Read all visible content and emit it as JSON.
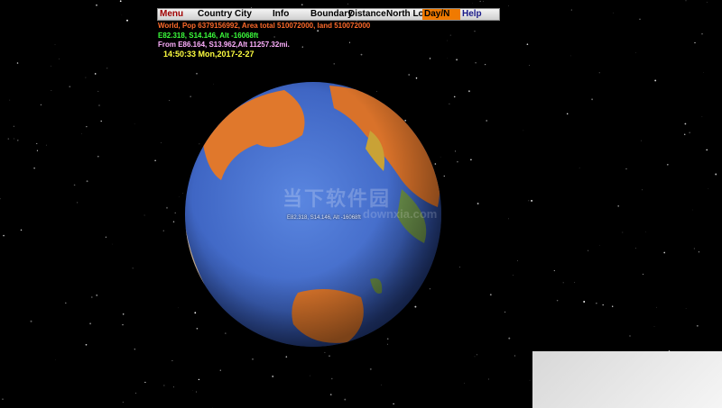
{
  "menu": {
    "items": [
      "Menu",
      "Country",
      "City",
      "Info",
      "Boundary",
      "Distance",
      "North Lock",
      "Day/N",
      "Help"
    ]
  },
  "info": {
    "line1": "World, Pop  6379156992, Area total 510072000, land 510072000",
    "line2": "E82.318, S14.146, Alt -16068ft",
    "line3": "From E86.164, S13.962,Alt 11257.32mi.",
    "clock": "14:50:33 Mon,2017-2-27"
  },
  "globe": {
    "cursor_label": "E82.318, S14.146, Alt -16068ft"
  },
  "watermark": {
    "main": "当下软件园",
    "sub": "downxia.com"
  },
  "colors": {
    "background": "#000000",
    "ocean": "#3f66c4",
    "land": "#e27a2a",
    "menu_active": "#f07a00",
    "info_line1": "#ff6a2a",
    "info_line2": "#3cff3c",
    "info_line3": "#ffb0ff",
    "clock": "#ffff40"
  }
}
